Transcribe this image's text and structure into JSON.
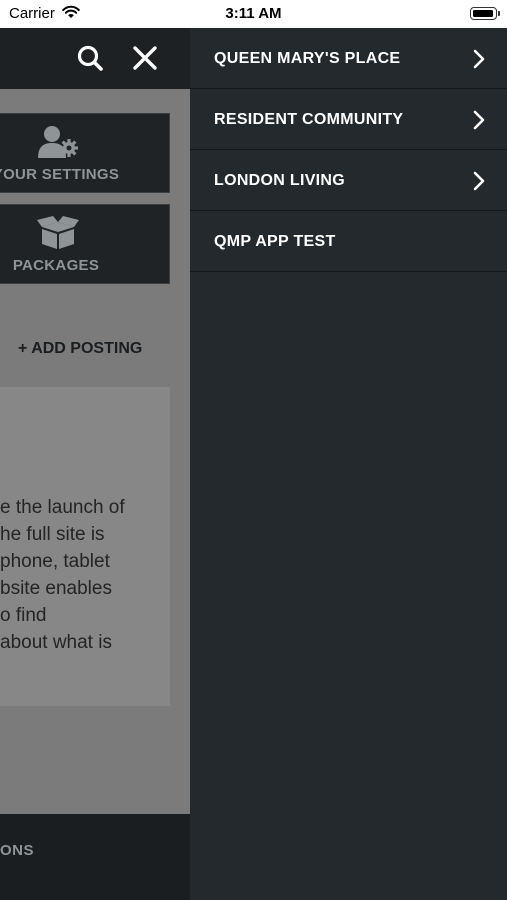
{
  "status_bar": {
    "carrier": "Carrier",
    "time": "3:11 AM"
  },
  "main": {
    "header": {
      "search_icon": "search-icon",
      "close_icon": "close-icon"
    },
    "tiles": [
      {
        "label": "YOUR SETTINGS",
        "icon": "user-settings-icon"
      },
      {
        "label": "PACKAGES",
        "icon": "package-icon"
      }
    ],
    "add_posting": "+ ADD POSTING",
    "content_text": "e the launch of\nhe full site is\nphone, tablet\nbsite enables\no find\nabout what is",
    "bottom_label": "ONS"
  },
  "drawer": {
    "items": [
      {
        "label": "QUEEN MARY'S PLACE",
        "has_submenu": true
      },
      {
        "label": "RESIDENT COMMUNITY",
        "has_submenu": true
      },
      {
        "label": "LONDON LIVING",
        "has_submenu": true
      },
      {
        "label": "QMP APP TEST",
        "has_submenu": false
      }
    ]
  },
  "colors": {
    "drawer_bg": "#23292d",
    "header_bg": "#1d2124",
    "overlay_bg": "#7b7b7b",
    "text_light": "#ffffff"
  }
}
